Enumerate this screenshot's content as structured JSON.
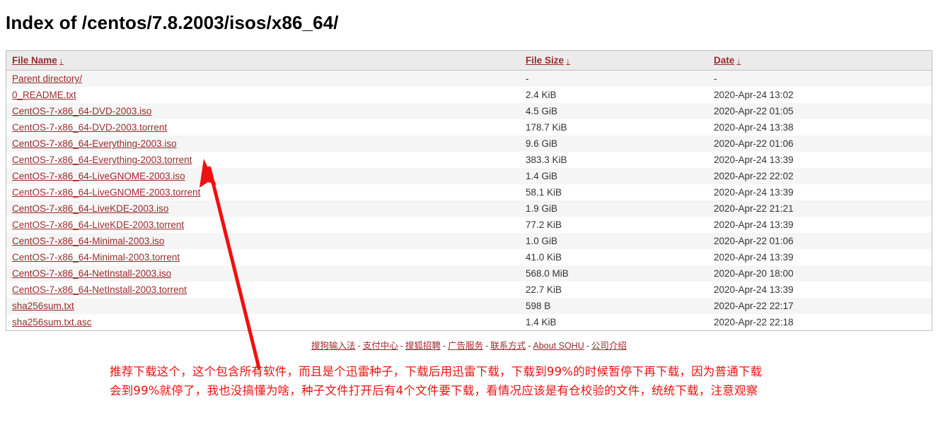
{
  "page": {
    "title": "Index of /centos/7.8.2003/isos/x86_64/"
  },
  "table": {
    "columns": [
      {
        "label": "File Name",
        "sort_icon": "↓"
      },
      {
        "label": "File Size",
        "sort_icon": "↓"
      },
      {
        "label": "Date",
        "sort_icon": "↓"
      }
    ],
    "rows": [
      {
        "name": "Parent directory/",
        "size": "-",
        "date": "-"
      },
      {
        "name": "0_README.txt",
        "size": "2.4 KiB",
        "date": "2020-Apr-24 13:02"
      },
      {
        "name": "CentOS-7-x86_64-DVD-2003.iso",
        "size": "4.5 GiB",
        "date": "2020-Apr-22 01:05"
      },
      {
        "name": "CentOS-7-x86_64-DVD-2003.torrent",
        "size": "178.7 KiB",
        "date": "2020-Apr-24 13:38"
      },
      {
        "name": "CentOS-7-x86_64-Everything-2003.iso",
        "size": "9.6 GiB",
        "date": "2020-Apr-22 01:06"
      },
      {
        "name": "CentOS-7-x86_64-Everything-2003.torrent",
        "size": "383.3 KiB",
        "date": "2020-Apr-24 13:39"
      },
      {
        "name": "CentOS-7-x86_64-LiveGNOME-2003.iso",
        "size": "1.4 GiB",
        "date": "2020-Apr-22 22:02"
      },
      {
        "name": "CentOS-7-x86_64-LiveGNOME-2003.torrent",
        "size": "58.1 KiB",
        "date": "2020-Apr-24 13:39"
      },
      {
        "name": "CentOS-7-x86_64-LiveKDE-2003.iso",
        "size": "1.9 GiB",
        "date": "2020-Apr-22 21:21"
      },
      {
        "name": "CentOS-7-x86_64-LiveKDE-2003.torrent",
        "size": "77.2 KiB",
        "date": "2020-Apr-24 13:39"
      },
      {
        "name": "CentOS-7-x86_64-Minimal-2003.iso",
        "size": "1.0 GiB",
        "date": "2020-Apr-22 01:06"
      },
      {
        "name": "CentOS-7-x86_64-Minimal-2003.torrent",
        "size": "41.0 KiB",
        "date": "2020-Apr-24 13:39"
      },
      {
        "name": "CentOS-7-x86_64-NetInstall-2003.iso",
        "size": "568.0 MiB",
        "date": "2020-Apr-20 18:00"
      },
      {
        "name": "CentOS-7-x86_64-NetInstall-2003.torrent",
        "size": "22.7 KiB",
        "date": "2020-Apr-24 13:39"
      },
      {
        "name": "sha256sum.txt",
        "size": "598 B",
        "date": "2020-Apr-22 22:17"
      },
      {
        "name": "sha256sum.txt.asc",
        "size": "1.4 KiB",
        "date": "2020-Apr-22 22:18"
      }
    ]
  },
  "footer": {
    "separator": "-",
    "links": [
      "搜狗输入法",
      "支付中心",
      "搜狐招聘",
      "广告服务",
      "联系方式",
      "About SOHU",
      "公司介绍"
    ]
  },
  "annotation": {
    "color": "#ee1111",
    "lines": [
      "推荐下载这个，这个包含所有软件，而且是个迅雷种子，下载后用迅雷下载，下载到99%的时候暂停下再下载，因为普通下载",
      "会到99%就停了，我也没搞懂为啥，种子文件打开后有4个文件要下载，看情况应该是有仓校验的文件，统统下载，注意观察"
    ]
  },
  "arrow": {
    "color": "#ee1111",
    "points_to_row": "CentOS-7-x86_64-Everything-2003.torrent"
  }
}
